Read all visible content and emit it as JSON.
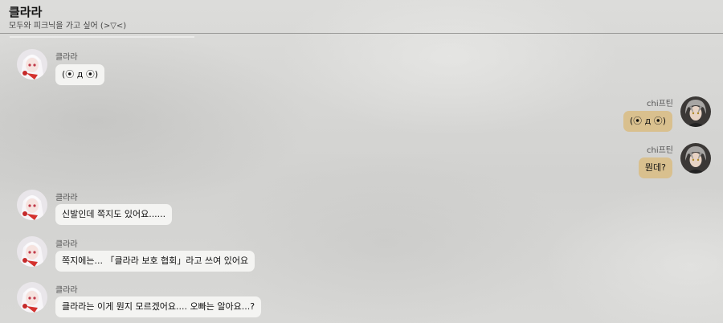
{
  "header": {
    "title": "클라라",
    "subtitle": "모두와 피크닉을 가고 싶어 (>▽<)"
  },
  "messages": [
    {
      "sender": "클라라",
      "text": "(⦿ д ⦿)"
    },
    {
      "sender": "chi프틴",
      "text": "(⦿ д ⦿)"
    },
    {
      "sender": "chi프틴",
      "text": "뭔데?"
    },
    {
      "sender": "클라라",
      "text": "신발인데 쪽지도 있어요......"
    },
    {
      "sender": "클라라",
      "text": "쪽지에는... 「클라라 보호 협회」라고 쓰여 있어요"
    },
    {
      "sender": "클라라",
      "text": "클라라는 이게 뭔지 모르겠어요.... 오빠는 알아요...?"
    }
  ],
  "colors": {
    "left_bubble": "#f4f4f2",
    "right_bubble": "#d9c08e"
  },
  "icons": {
    "clara_avatar": "white-haired-girl-avatar",
    "player_avatar": "grey-haired-man-avatar"
  }
}
